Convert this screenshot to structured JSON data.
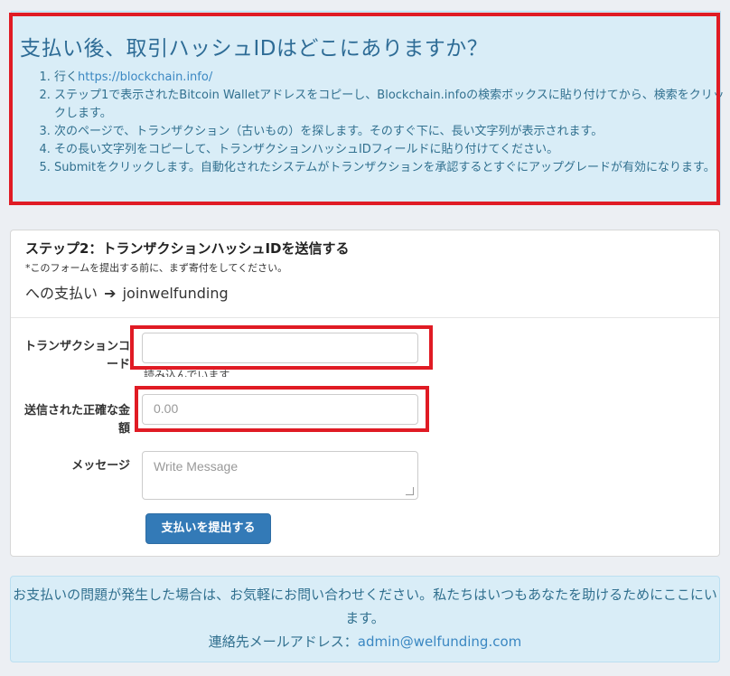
{
  "info": {
    "title": "支払い後、取引ハッシュIDはどこにありますか？",
    "steps": [
      {
        "prefix": "行く",
        "link": "https://blockchain.info/"
      },
      {
        "text": "ステップ1で表示されたBitcoin Walletアドレスをコピーし、Blockchain.infoの検索ボックスに貼り付けてから、検索をクリックします。"
      },
      {
        "text": "次のページで、トランザクション（古いもの）を探します。そのすぐ下に、長い文字列が表示されます。"
      },
      {
        "text": "その長い文字列をコピーして、トランザクションハッシュIDフィールドに貼り付けてください。"
      },
      {
        "text": "Submitをクリックします。自動化されたシステムがトランザクションを承認するとすぐにアップグレードが有効になります。"
      }
    ]
  },
  "form": {
    "title": "ステップ2：トランザクションハッシュIDを送信する",
    "note": "*このフォームを提出する前に、まず寄付をしてください。",
    "pay_to_prefix": "への支払い",
    "pay_to_arrow": "➔",
    "pay_to_name": "joinwelfunding",
    "transaction_label": "トランザクションコード",
    "transaction_value": "",
    "loading_text": "読み込んでいます...",
    "amount_label": "送信された正確な金額",
    "amount_placeholder": "0.00",
    "message_label": "メッセージ",
    "message_placeholder": "Write Message",
    "submit_label": "支払いを提出する"
  },
  "help": {
    "line1": "お支払いの問題が発生した場合は、お気軽にお問い合わせください。私たちはいつもあなたを助けるためにここにいます。",
    "contact_prefix": "連絡先メールアドレス：",
    "email": "admin@welfunding.com"
  },
  "colors": {
    "info_bg": "#d9edf7",
    "info_text": "#31708f",
    "highlight_red": "#e01b24",
    "primary_button": "#337ab7"
  }
}
